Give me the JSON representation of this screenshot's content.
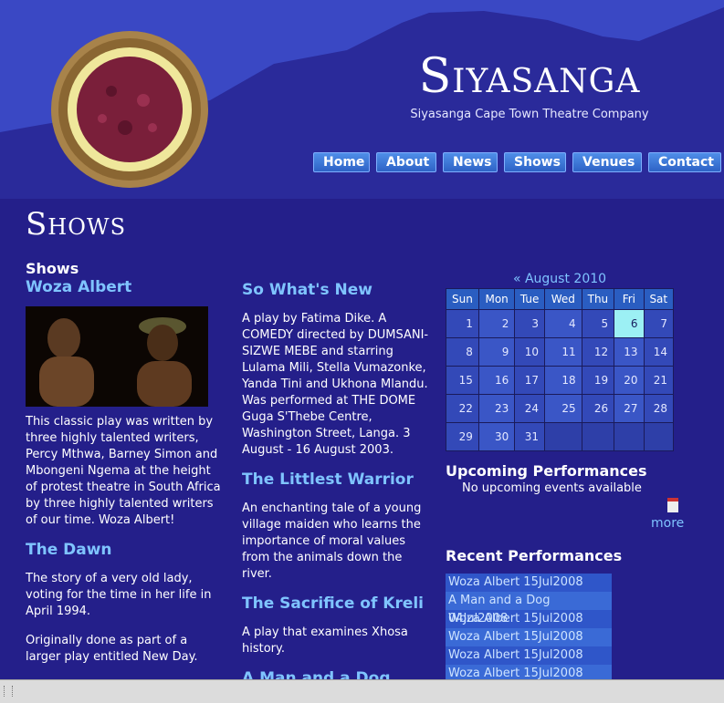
{
  "brand": {
    "title": "Siyasanga",
    "tagline": "Siyasanga Cape Town Theatre Company"
  },
  "nav": [
    "Home",
    "About",
    "News",
    "Shows",
    "Venues",
    "Contact"
  ],
  "page_title": "Shows",
  "shows_heading": "Shows",
  "col1": {
    "woza_title": "Woza Albert",
    "woza_desc": "This classic play was written by three highly talented writers, Percy Mthwa, Barney Simon and Mbongeni Ngema at the height of protest theatre in South Africa by three highly talented writers of our time. Woza Albert!",
    "dawn_title": "The Dawn",
    "dawn_desc1": "The story of a very old lady, voting for the time in her life in April 1994.",
    "dawn_desc2": "Originally done as part of a larger play entitled New Day."
  },
  "col2": {
    "whatsnew_title": "So What's New",
    "whatsnew_desc": "A play by Fatima Dike. A COMEDY directed by DUMSANI-SIZWE MEBE and starring Lulama Mili, Stella Vumazonke, Yanda Tini and Ukhona Mlandu. Was performed at THE DOME Guga S'Thebe Centre, Washington Street, Langa. 3 August - 16 August 2003.",
    "warrior_title": "The Littlest Warrior",
    "warrior_desc": "An enchanting tale of a young village maiden who learns the importance of moral values from the animals down the river.",
    "kreli_title": "The Sacrifice of Kreli",
    "kreli_desc": "A play that examines Xhosa history.",
    "dog_title": "A Man and a Dog"
  },
  "calendar": {
    "month": "« August 2010",
    "days": [
      "Sun",
      "Mon",
      "Tue",
      "Wed",
      "Thu",
      "Fri",
      "Sat"
    ],
    "weeks": [
      [
        "",
        "",
        "",
        "",
        "",
        "",
        ""
      ],
      [
        "1",
        "2",
        "3",
        "4",
        "5",
        "6",
        "7"
      ],
      [
        "8",
        "9",
        "10",
        "11",
        "12",
        "13",
        "14"
      ],
      [
        "15",
        "16",
        "17",
        "18",
        "19",
        "20",
        "21"
      ],
      [
        "22",
        "23",
        "24",
        "25",
        "26",
        "27",
        "28"
      ],
      [
        "29",
        "30",
        "31",
        "",
        "",
        "",
        ""
      ]
    ],
    "today": "6"
  },
  "upcoming": {
    "heading": "Upcoming Performances",
    "none": "No upcoming events available",
    "more": "more"
  },
  "recent": {
    "heading": "Recent Performances",
    "items": [
      "Woza Albert 15Jul2008",
      "A Man and a Dog 04Jul2008",
      "Woza Albert 15Jul2008",
      "Woza Albert 15Jul2008",
      "Woza Albert 15Jul2008",
      "Woza Albert 15Jul2008"
    ]
  },
  "colors": {
    "background": "#241f8a",
    "header": "#2e3ab9",
    "link": "#7fc4ff",
    "today": "#9cf0f4"
  }
}
